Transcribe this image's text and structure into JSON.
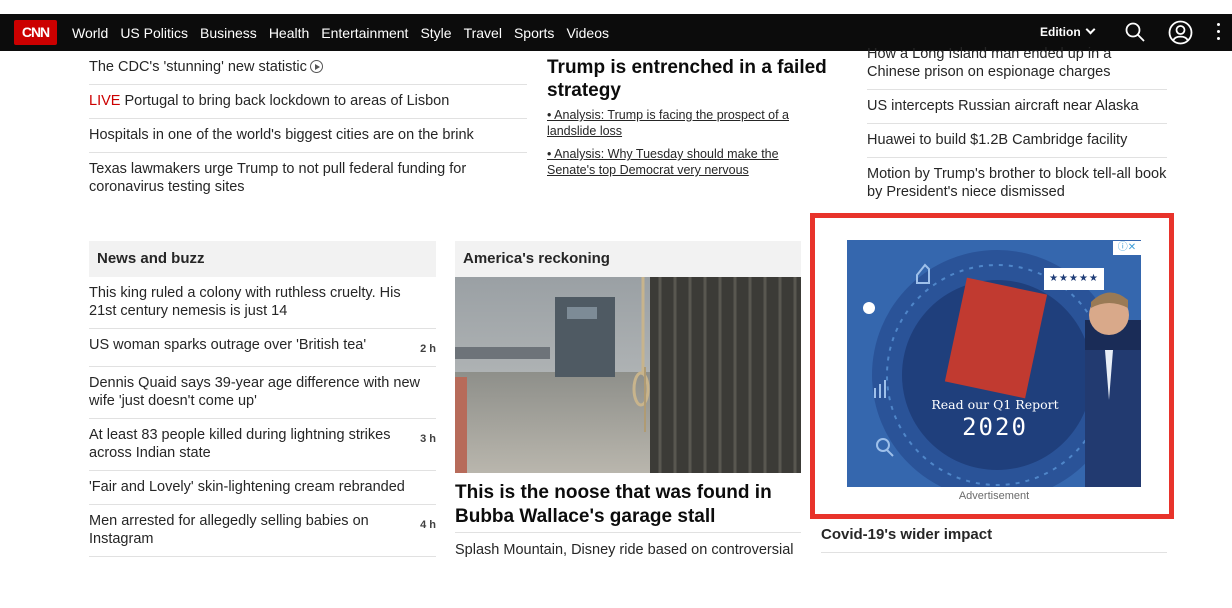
{
  "nav": {
    "logo": "CNN",
    "items": [
      "World",
      "US Politics",
      "Business",
      "Health",
      "Entertainment",
      "Style",
      "Travel",
      "Sports",
      "Videos"
    ],
    "edition_label": "Edition"
  },
  "left_top_list": [
    {
      "text": "The CDC's 'stunning' new statistic",
      "video": true
    },
    {
      "live": "LIVE",
      "text": " Portugal to bring back lockdown to areas of Lisbon"
    },
    {
      "text": "Hospitals in one of the world's biggest cities are on the brink"
    },
    {
      "text": "Texas lawmakers urge Trump to not pull federal funding for coronavirus testing sites"
    }
  ],
  "lead_story": {
    "title": "Trump is entrenched in a failed strategy",
    "sub_1": "• Analysis: Trump is facing the prospect of a landslide loss",
    "sub_2": "• Analysis: Why Tuesday should make the Senate's top Democrat very nervous"
  },
  "right_top_list": [
    "How a Long Island man ended up in a Chinese prison on espionage charges",
    "US intercepts Russian aircraft near Alaska",
    "Huawei to build $1.2B Cambridge facility",
    "Motion by Trump's brother to block tell-all book by President's niece dismissed"
  ],
  "news_and_buzz": {
    "heading": "News and buzz",
    "items": [
      {
        "text": "This king ruled a colony with ruthless cruelty. His 21st century nemesis is just 14",
        "age": ""
      },
      {
        "text": "US woman sparks outrage over 'British tea'",
        "age": "2 h"
      },
      {
        "text": "Dennis Quaid says 39-year age difference with new wife 'just doesn't come up'",
        "age": ""
      },
      {
        "text": "At least 83 people killed during lightning strikes across Indian state",
        "age": "3 h"
      },
      {
        "text": "'Fair and Lovely' skin-lightening cream rebranded",
        "age": ""
      },
      {
        "text": "Men arrested for allegedly selling babies on Instagram",
        "age": "4 h"
      }
    ]
  },
  "americas_reckoning": {
    "heading": "America's reckoning",
    "headline": "This is the noose that was found in Bubba Wallace's garage stall",
    "sub_headline": "Splash Mountain, Disney ride based on controversial"
  },
  "ad": {
    "line_1": "Read our Q1 Report",
    "line_2": "2020",
    "stars": "★★★★★",
    "choices_glyphs": "ⓘ✕",
    "label": "Advertisement"
  },
  "covid": {
    "heading": "Covid-19's wider impact"
  }
}
